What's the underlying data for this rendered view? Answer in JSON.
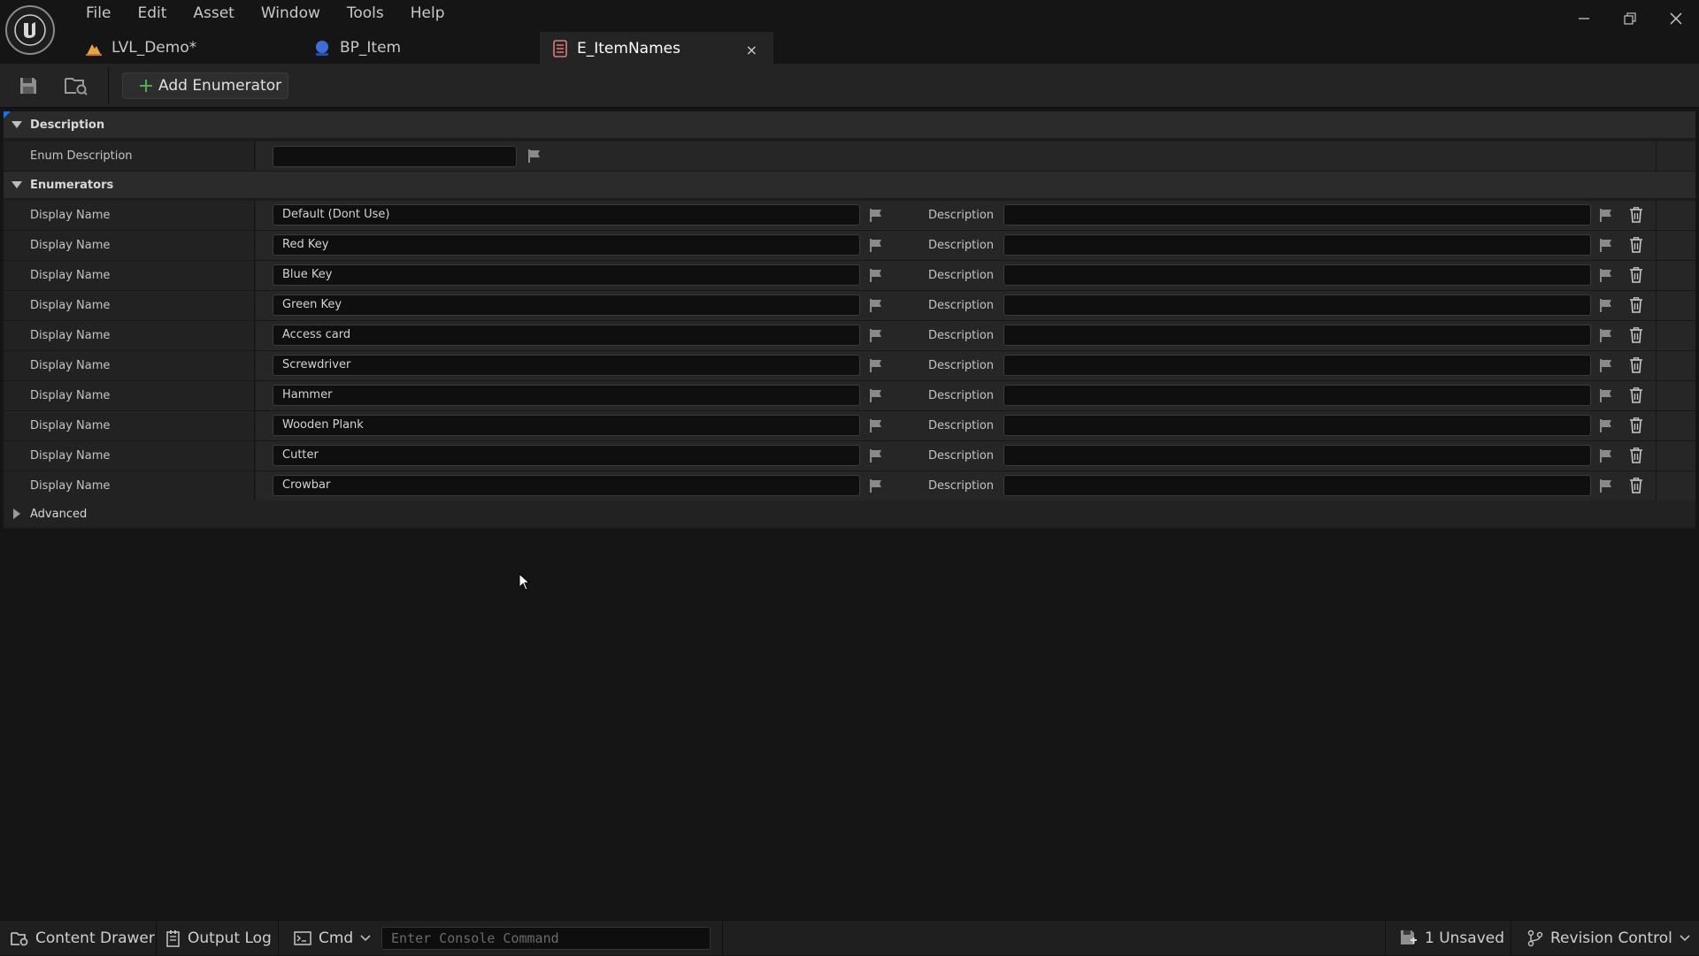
{
  "menu": [
    "File",
    "Edit",
    "Asset",
    "Window",
    "Tools",
    "Help"
  ],
  "tabs": [
    {
      "label": "LVL_Demo*",
      "icon": "level-icon"
    },
    {
      "label": "BP_Item",
      "icon": "blueprint-icon"
    },
    {
      "label": "E_ItemNames",
      "icon": "enum-icon",
      "active": true,
      "close": "×"
    }
  ],
  "toolbar": {
    "add_label": "Add Enumerator"
  },
  "sections": {
    "description": {
      "title": "Description",
      "field_label": "Enum Description",
      "field_value": ""
    },
    "enumerators": {
      "title": "Enumerators",
      "name_label": "Display Name",
      "desc_label": "Description",
      "items": [
        {
          "display_name": "Default (Dont Use)",
          "description": ""
        },
        {
          "display_name": "Red Key",
          "description": ""
        },
        {
          "display_name": "Blue Key",
          "description": ""
        },
        {
          "display_name": "Green Key",
          "description": ""
        },
        {
          "display_name": "Access card",
          "description": ""
        },
        {
          "display_name": "Screwdriver",
          "description": ""
        },
        {
          "display_name": "Hammer",
          "description": ""
        },
        {
          "display_name": "Wooden Plank",
          "description": ""
        },
        {
          "display_name": "Cutter",
          "description": ""
        },
        {
          "display_name": "Crowbar",
          "description": ""
        }
      ]
    },
    "advanced": {
      "title": "Advanced"
    }
  },
  "statusbar": {
    "content_drawer": "Content Drawer",
    "output_log": "Output Log",
    "cmd": "Cmd",
    "console_placeholder": "Enter Console Command",
    "unsaved": "1 Unsaved",
    "revision_control": "Revision Control"
  },
  "colors": {
    "accent": "#1e6fd9",
    "background": "#151515",
    "panel": "#1c1c1c",
    "level_icon": "#e8a33c",
    "blueprint_icon": "#3b6fd8"
  }
}
